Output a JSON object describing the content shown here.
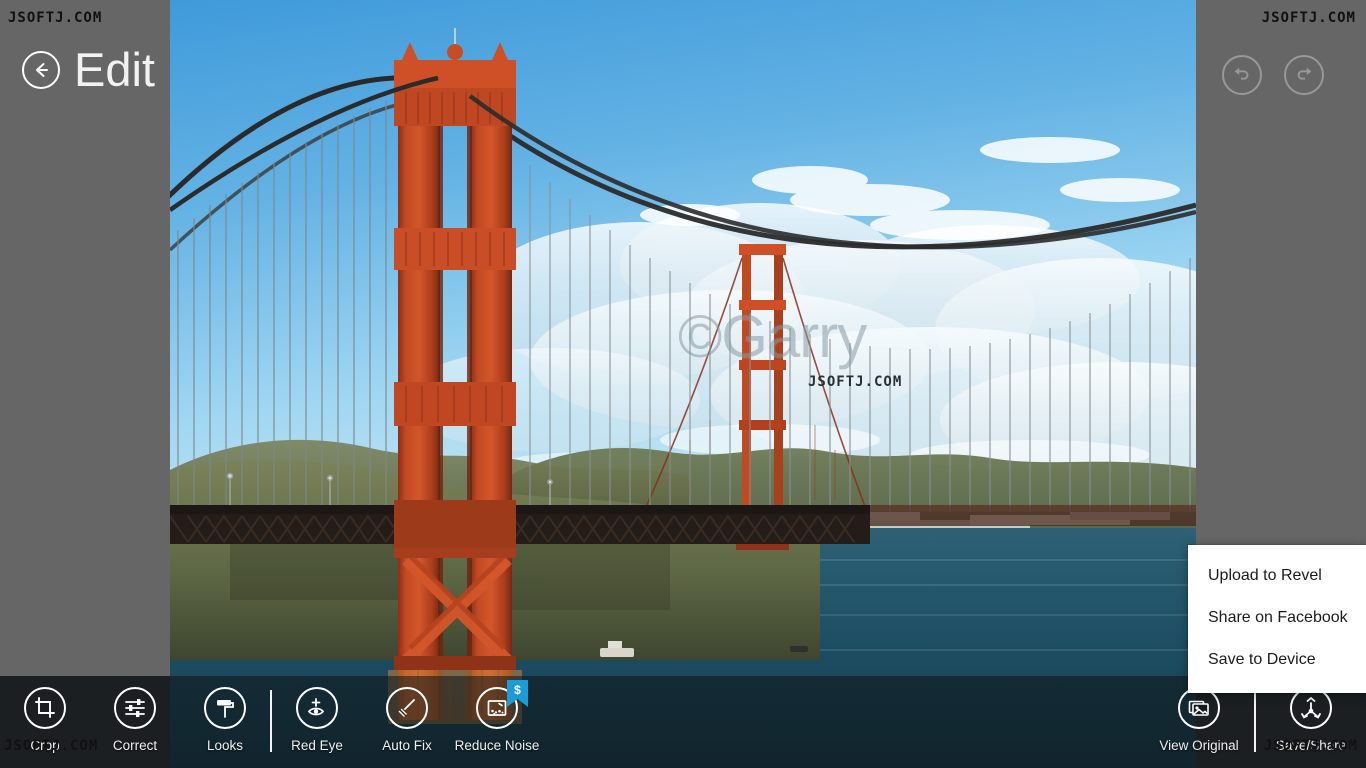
{
  "app": {
    "title": "Edit",
    "background_color": "#666666",
    "watermark_text": "JSOFTJ.COM",
    "photo_watermark": "©Garry"
  },
  "header": {
    "back_label": "Edit",
    "back_icon": "back-arrow-circle-icon",
    "undo_icon": "undo-icon",
    "redo_icon": "redo-icon"
  },
  "photo": {
    "name": "golden-gate-bridge-photo",
    "alt": "Golden Gate Bridge over the bay",
    "colors": {
      "sky_top": "#4da2dd",
      "sky_bottom": "#a9ddf6",
      "bridge_red": "#b8411f",
      "bridge_red_light": "#d4542a",
      "water": "#1d4a5c",
      "hills": "#6b7250"
    }
  },
  "toolbar": {
    "left_tools": [
      {
        "label": "Crop",
        "icon": "crop-icon",
        "badge": null
      },
      {
        "label": "Correct",
        "icon": "sliders-icon",
        "badge": null
      },
      {
        "label": "Looks",
        "icon": "paint-roller-icon",
        "badge": null
      },
      {
        "label": "Red Eye",
        "icon": "red-eye-icon",
        "badge": null
      },
      {
        "label": "Auto Fix",
        "icon": "squeegee-icon",
        "badge": null
      },
      {
        "label": "Reduce Noise",
        "icon": "reduce-noise-icon",
        "badge": "$"
      }
    ],
    "right_tools": [
      {
        "label": "View Original",
        "icon": "image-stack-icon"
      },
      {
        "label": "Save/Share",
        "icon": "share-icon"
      }
    ],
    "badge_color": "#1b9cd8"
  },
  "share_menu": {
    "items": [
      {
        "label": "Upload to Revel"
      },
      {
        "label": "Share on Facebook"
      },
      {
        "label": "Save to Device"
      }
    ]
  }
}
